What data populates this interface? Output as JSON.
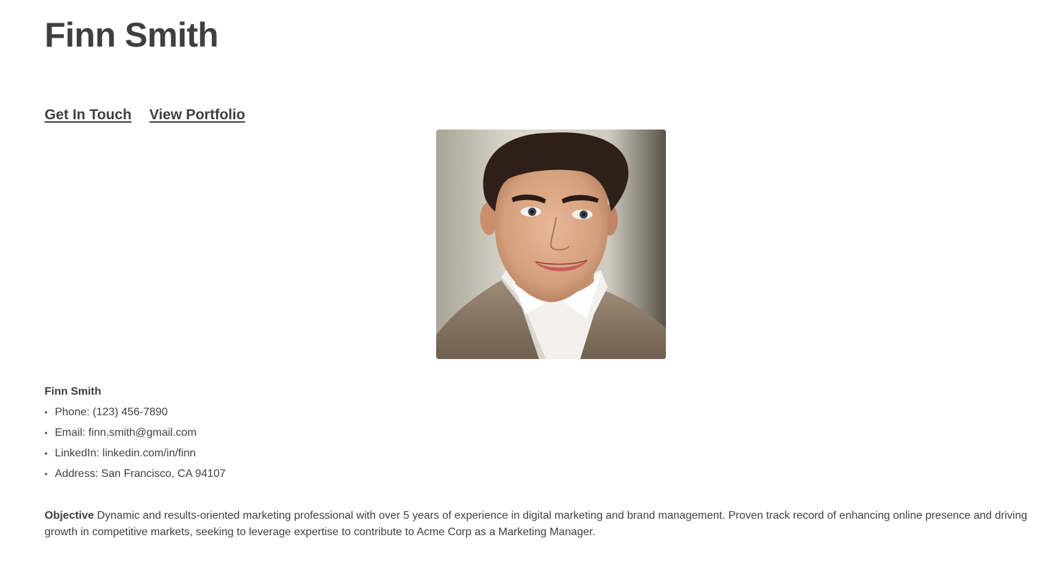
{
  "header": {
    "title": "Finn Smith"
  },
  "nav": {
    "links": [
      {
        "label": "Get In Touch"
      },
      {
        "label": "View Portfolio"
      }
    ]
  },
  "profile": {
    "photo_icon": "portrait-photo"
  },
  "contact": {
    "name": "Finn Smith",
    "bullet": "•",
    "items": [
      {
        "text": "Phone: (123) 456-7890"
      },
      {
        "text": "Email: finn.smith@gmail.com"
      },
      {
        "text": "LinkedIn: linkedin.com/in/finn"
      },
      {
        "text": "Address: San Francisco, CA 94107"
      }
    ]
  },
  "objective": {
    "label": "Objective",
    "text": "Dynamic and results-oriented marketing professional with over 5 years of experience in digital marketing and brand management. Proven track record of enhancing online presence and driving growth in competitive markets, seeking to leverage expertise to contribute to Acme Corp as a Marketing Manager."
  },
  "colors": {
    "text": "#3f3f3f",
    "background": "#ffffff"
  }
}
